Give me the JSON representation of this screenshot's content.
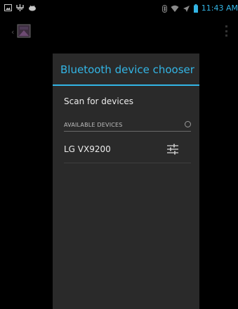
{
  "status_bar": {
    "time": "11:43 AM",
    "icons": [
      "gallery-icon",
      "usb-icon",
      "android-debug-icon",
      "bluetooth-icon",
      "wifi-icon",
      "airplane-mode-icon",
      "battery-icon"
    ]
  },
  "app_bar": {
    "up_symbol": "‹",
    "icons": [
      "app-icon",
      "overflow-menu-icon"
    ]
  },
  "dialog": {
    "title": "Bluetooth device chooser",
    "scan_label": "Scan for devices",
    "section_header": "AVAILABLE DEVICES",
    "devices": [
      {
        "name": "LG VX9200",
        "icon": "settings-sliders-icon"
      }
    ]
  },
  "colors": {
    "accent": "#33b5e5",
    "dialog_bg": "#2a2a2a",
    "page_bg": "#000000"
  }
}
